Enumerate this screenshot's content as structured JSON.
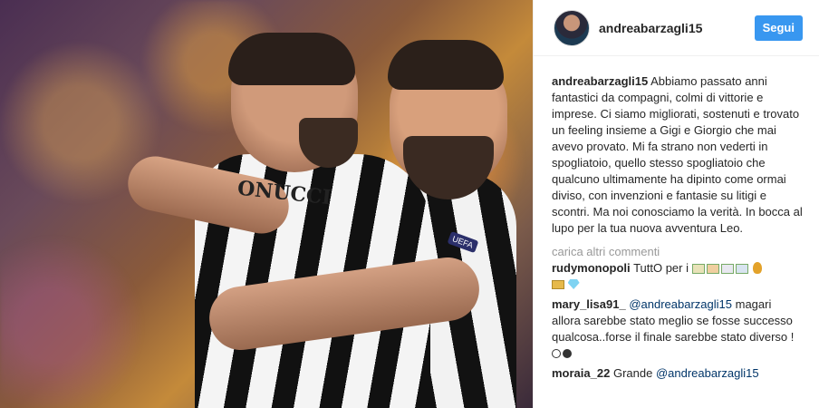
{
  "post": {
    "username": "andreabarzagli15",
    "follow_label": "Segui"
  },
  "caption": {
    "username": "andreabarzagli15",
    "text": "Abbiamo passato anni fantastici da compagni, colmi di vittorie e imprese. Ci siamo migliorati, sostenuti e trovato un feeling insieme a Gigi e Giorgio che mai avevo provato. Mi fa strano non vederti in spogliatoio, quello stesso spogliatoio che qualcuno ultimamente ha dipinto come ormai diviso, con invenzioni e fantasie su litigi e scontri. Ma noi conosciamo la verità. In bocca al lupo per la tua nuova avventura Leo."
  },
  "load_more_label": "carica altri commenti",
  "comments": [
    {
      "username": "rudymonopoli",
      "text": "TuttO per i"
    },
    {
      "username": "mary_lisa91_",
      "mention": "@andreabarzagli15",
      "text": "magari allora sarebbe stato meglio se fosse successo qualcosa..forse il finale sarebbe stato diverso !"
    },
    {
      "username": "moraia_22",
      "text": "Grande",
      "mention": "@andreabarzagli15"
    }
  ],
  "photo": {
    "jersey_text": "ONUCCI",
    "sponsor_text": "UEFA"
  },
  "colors": {
    "follow_button": "#3897f0",
    "mention": "#003569",
    "muted": "#999999"
  }
}
